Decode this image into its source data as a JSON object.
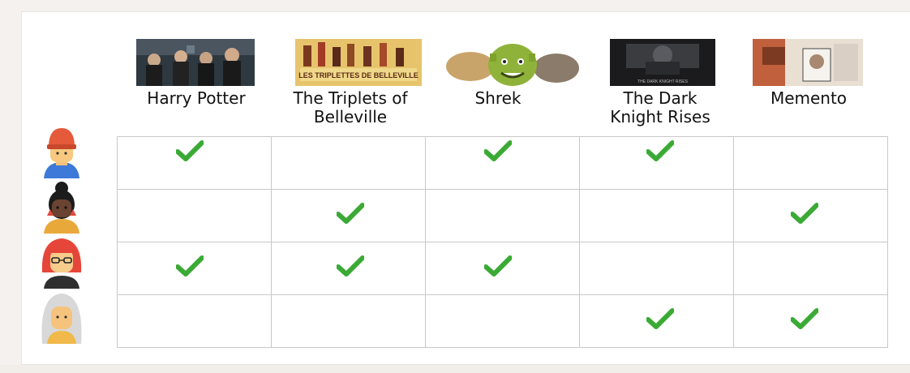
{
  "movies": [
    {
      "title": "Harry Potter"
    },
    {
      "title_line1": "The Triplets of",
      "title_line2": "Belleville"
    },
    {
      "title": "Shrek"
    },
    {
      "title_line1": "The Dark",
      "title_line2": "Knight Rises"
    },
    {
      "title": "Memento"
    }
  ],
  "posters": {
    "triplets_banner": "LES TRIPLETTES DE BELLEVILLE",
    "dark_knight_caption": "THE DARK KNIGHT RISES"
  },
  "users": [
    "user-red-hat",
    "user-bun-hair",
    "user-red-hair-glasses",
    "user-gray-hair"
  ],
  "ratings": [
    [
      1,
      0,
      1,
      1,
      0
    ],
    [
      0,
      1,
      0,
      0,
      1
    ],
    [
      1,
      1,
      1,
      0,
      0
    ],
    [
      0,
      0,
      0,
      1,
      1
    ]
  ],
  "colors": {
    "check": "#3aaa35",
    "grid": "#c8c8c8"
  }
}
